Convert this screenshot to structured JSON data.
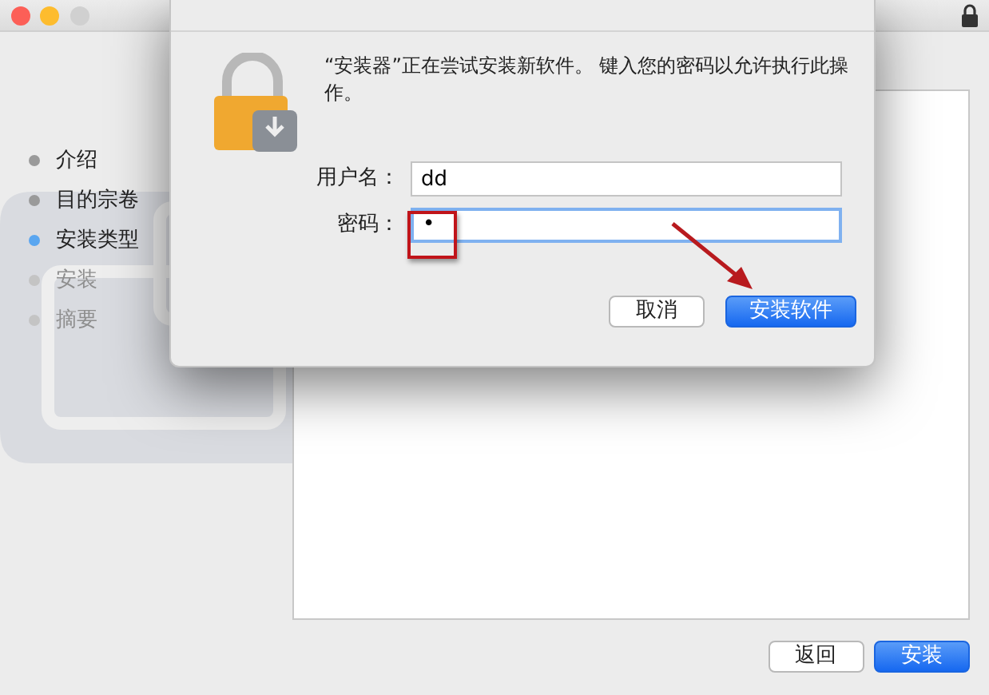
{
  "window": {
    "steps": [
      {
        "label": "介绍",
        "selected": false,
        "disabled": false
      },
      {
        "label": "目的宗卷",
        "selected": false,
        "disabled": false
      },
      {
        "label": "安装类型",
        "selected": true,
        "disabled": false
      },
      {
        "label": "安装",
        "selected": false,
        "disabled": true
      },
      {
        "label": "摘要",
        "selected": false,
        "disabled": true
      }
    ],
    "buttons": [
      {
        "label": "返回",
        "primary": false
      },
      {
        "label": "安装",
        "primary": true
      }
    ]
  },
  "dialog": {
    "message": "“安装器”正在尝试安装新软件。 键入您的密码以允许执行此操作。",
    "fields": [
      {
        "label": "用户名：",
        "value": "dd",
        "focused": false
      },
      {
        "label": "密码：",
        "value": "•",
        "focused": true
      }
    ],
    "buttons": [
      {
        "label": "取消",
        "primary": false
      },
      {
        "label": "安装软件",
        "primary": true
      }
    ]
  }
}
